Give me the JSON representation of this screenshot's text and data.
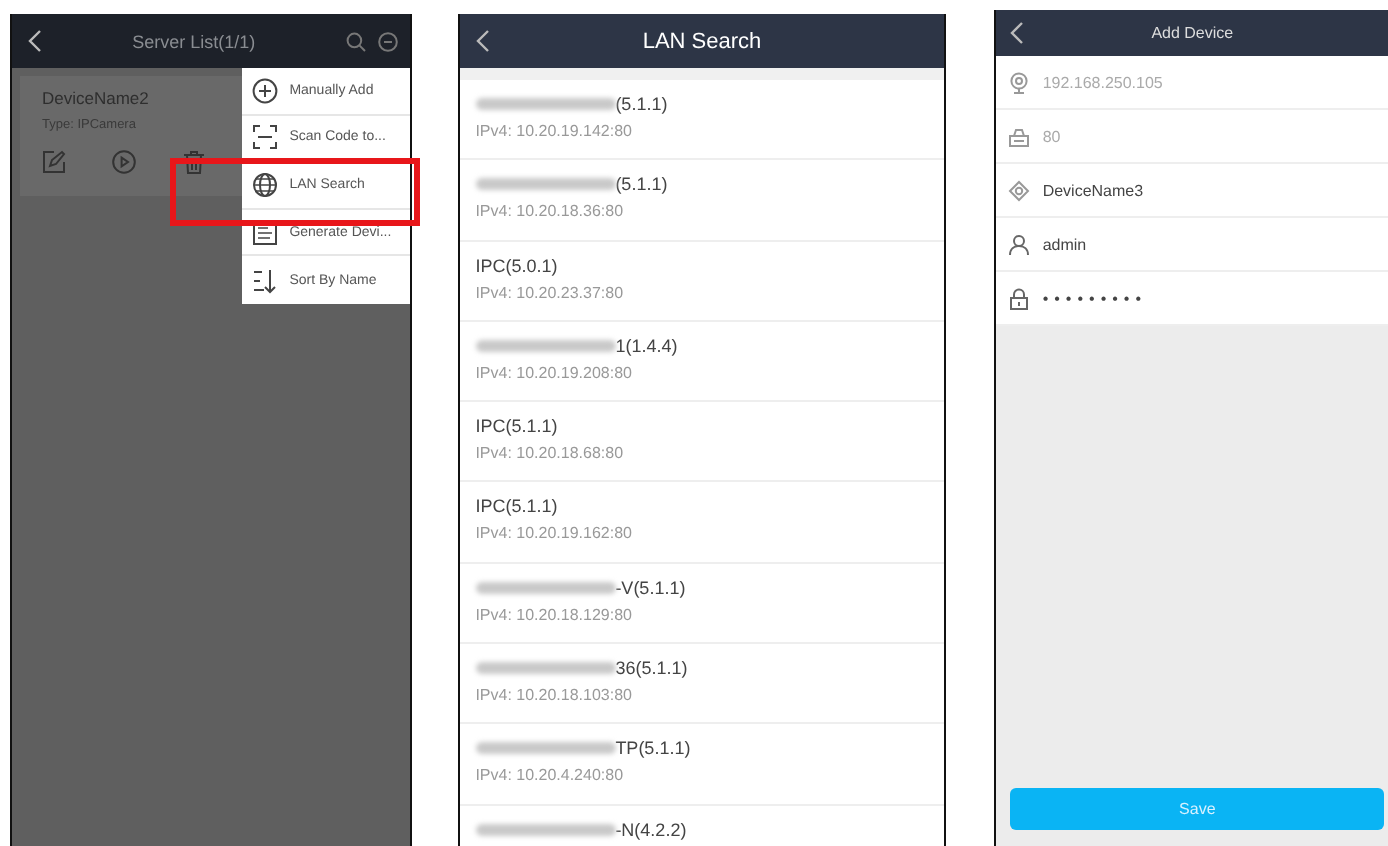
{
  "server_list": {
    "title": "Server List(1/1)",
    "device": {
      "name": "DeviceName2",
      "type": "Type: IPCamera"
    },
    "menu": [
      {
        "label": "Manually Add",
        "highlighted": false
      },
      {
        "label": "Scan Code to...",
        "highlighted": false
      },
      {
        "label": "LAN Search",
        "highlighted": true
      },
      {
        "label": "Generate Devi...",
        "highlighted": false
      },
      {
        "label": "Sort By Name",
        "highlighted": false
      }
    ]
  },
  "lan_search": {
    "title": "LAN Search",
    "devices": [
      {
        "name": "(5.1.1)",
        "redacted": true,
        "address": "IPv4: 10.20.19.142:80"
      },
      {
        "name": "(5.1.1)",
        "redacted": true,
        "address": "IPv4: 10.20.18.36:80"
      },
      {
        "name": "IPC(5.0.1)",
        "redacted": false,
        "address": "IPv4: 10.20.23.37:80"
      },
      {
        "name": "1(1.4.4)",
        "redacted": true,
        "address": "IPv4: 10.20.19.208:80"
      },
      {
        "name": "IPC(5.1.1)",
        "redacted": false,
        "address": "IPv4: 10.20.18.68:80"
      },
      {
        "name": "IPC(5.1.1)",
        "redacted": false,
        "address": "IPv4: 10.20.19.162:80"
      },
      {
        "name": "-V(5.1.1)",
        "redacted": true,
        "address": "IPv4: 10.20.18.129:80"
      },
      {
        "name": "36(5.1.1)",
        "redacted": true,
        "address": "IPv4: 10.20.18.103:80"
      },
      {
        "name": "TP(5.1.1)",
        "redacted": true,
        "address": "IPv4: 10.20.4.240:80"
      },
      {
        "name": "-N(4.2.2)",
        "redacted": true
      }
    ]
  },
  "add_device": {
    "title": "Add Device",
    "fields": [
      {
        "kind": "ip",
        "placeholder": "192.168.250.105"
      },
      {
        "kind": "port",
        "placeholder": "80"
      },
      {
        "kind": "name",
        "value": "DeviceName3"
      },
      {
        "kind": "user",
        "value": "admin"
      },
      {
        "kind": "password",
        "value": "•••••••••"
      }
    ],
    "save": "Save"
  }
}
